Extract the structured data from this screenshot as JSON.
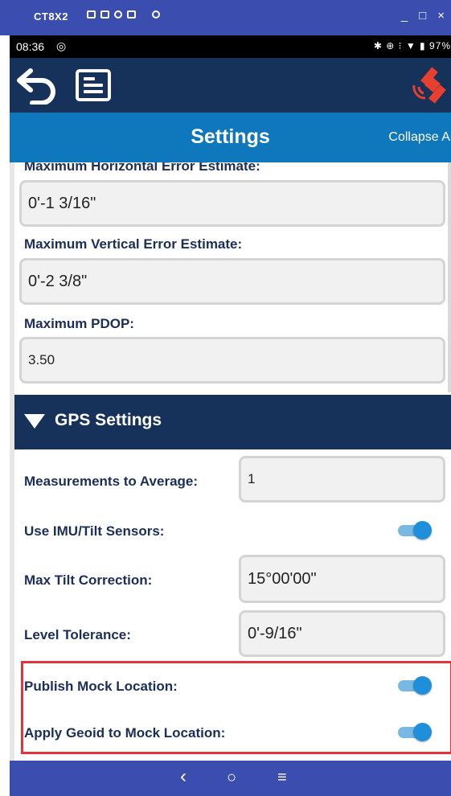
{
  "window": {
    "title": "CT8X2",
    "minimize_glyph": "_",
    "maximize_glyph": "□",
    "close_glyph": "×"
  },
  "statusbar": {
    "time": "08:36",
    "right_text": "✱ ⊕ ⁝ ▼ ▮ 97%"
  },
  "toolbar": {
    "back_icon": "back-arrow-icon",
    "menu_icon": "list-menu-icon",
    "status_icon": "satellite-icon"
  },
  "header": {
    "title": "Settings",
    "collapse_all": "Collapse All"
  },
  "tolerances": {
    "max_horizontal_label": "Maximum Horizontal Error Estimate:",
    "max_horizontal_value": "0'-1 3/16\"",
    "max_vertical_label": "Maximum Vertical Error Estimate:",
    "max_vertical_value": "0'-2 3/8\"",
    "max_pdop_label": "Maximum PDOP:",
    "max_pdop_value": "3.50"
  },
  "gps_settings": {
    "title": "GPS Settings",
    "measurements_label": "Measurements to Average:",
    "measurements_value": "1",
    "imu_label": "Use IMU/Tilt Sensors:",
    "imu_on": true,
    "max_tilt_label": "Max Tilt Correction:",
    "max_tilt_value": "15°00'00\"",
    "level_tolerance_label": "Level Tolerance:",
    "level_tolerance_value": "0'-9/16\"",
    "publish_mock_label": "Publish Mock Location:",
    "publish_mock_on": true,
    "apply_geoid_label": "Apply Geoid to Mock Location:",
    "apply_geoid_on": true
  },
  "navbar": {
    "back_glyph": "‹",
    "home_glyph": "○",
    "recents_glyph": "≡"
  },
  "colors": {
    "toolbar": "#16315a",
    "header": "#0f78bd",
    "toggle_on": "#1e8fd8",
    "highlight": "#e0353f"
  }
}
